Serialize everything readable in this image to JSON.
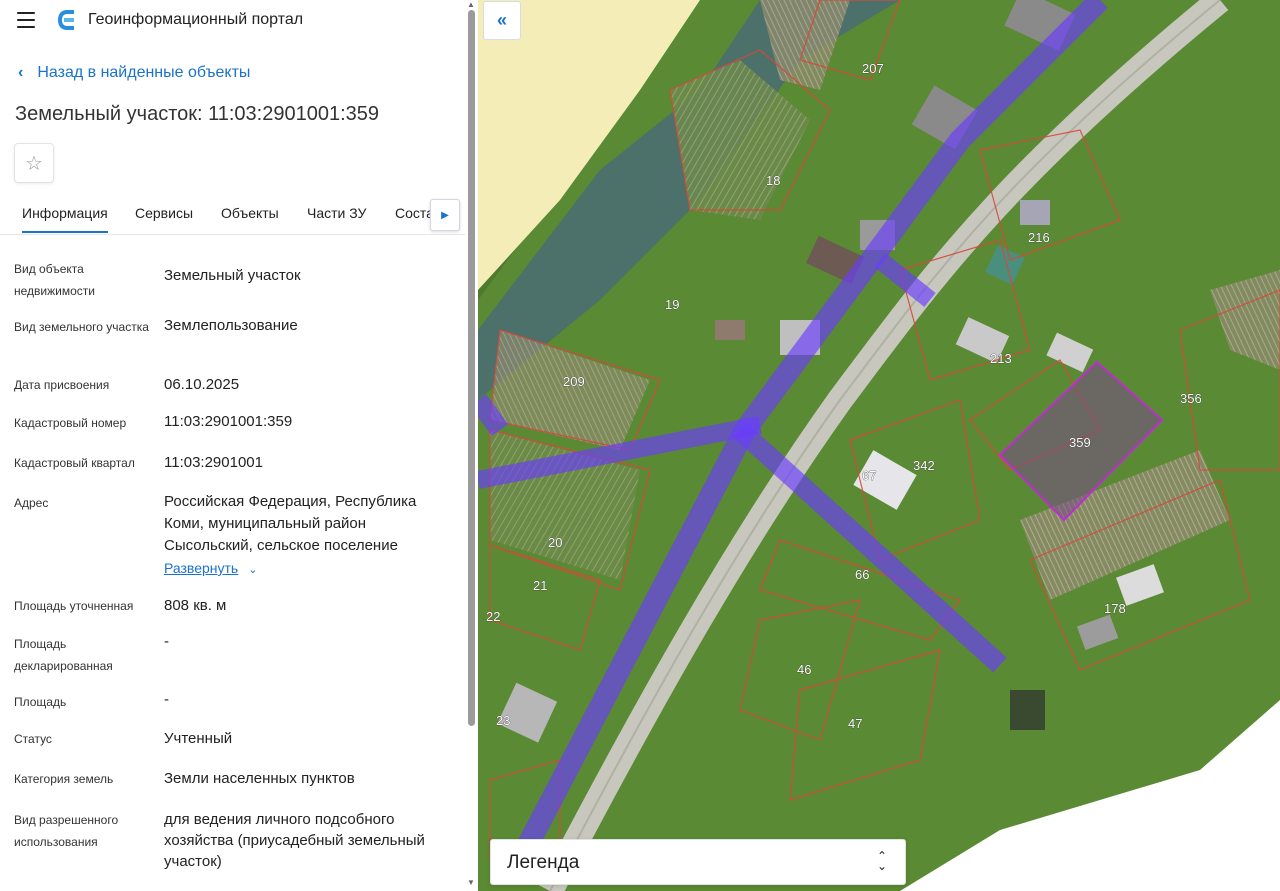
{
  "app": {
    "title": "Геоинформационный портал"
  },
  "nav": {
    "back_label": "Назад в найденные объекты"
  },
  "object": {
    "title": "Земельный участок: 11:03:2901001:359"
  },
  "tabs": [
    {
      "label": "Информация",
      "active": true
    },
    {
      "label": "Сервисы"
    },
    {
      "label": "Объекты"
    },
    {
      "label": "Части ЗУ"
    },
    {
      "label": "Соста"
    }
  ],
  "properties": {
    "object_type": {
      "label": "Вид объекта недвижимости",
      "value": "Земельный участок"
    },
    "parcel_type": {
      "label": "Вид земельного участка",
      "value": "Землепользование"
    },
    "assign_date": {
      "label": "Дата присвоения",
      "value": "06.10.2025"
    },
    "cadastral_number": {
      "label": "Кадастровый номер",
      "value": "11:03:2901001:359"
    },
    "cadastral_quarter": {
      "label": "Кадастровый квартал",
      "value": "11:03:2901001"
    },
    "address": {
      "label": "Адрес",
      "value": "Российская Федерация, Республика Коми, муниципальный район Сысольский, сельское поселение",
      "expand_label": "Развернуть"
    },
    "area_refined": {
      "label": "Площадь уточненная",
      "value": "808 кв. м"
    },
    "area_declared": {
      "label": "Площадь декларированная",
      "value": "-"
    },
    "area": {
      "label": "Площадь",
      "value": "-"
    },
    "status": {
      "label": "Статус",
      "value": "Учтенный"
    },
    "land_category": {
      "label": "Категория земель",
      "value": "Земли населенных пунктов"
    },
    "permitted_use": {
      "label": "Вид разрешенного использования",
      "value": "для ведения личного подсобного хозяйства (приусадебный земельный участок)"
    }
  },
  "map": {
    "parcel_labels": [
      "207",
      "18",
      "216",
      "19",
      "213",
      "209",
      "356",
      "359",
      "342",
      "67",
      "20",
      "66",
      "21",
      "178",
      "22",
      "46",
      "47",
      "23"
    ],
    "legend_label": "Легенда"
  },
  "colors": {
    "accent": "#1a73c9",
    "highlight_parcel": "#c02bd4",
    "zone_band": "#6a3cff"
  }
}
